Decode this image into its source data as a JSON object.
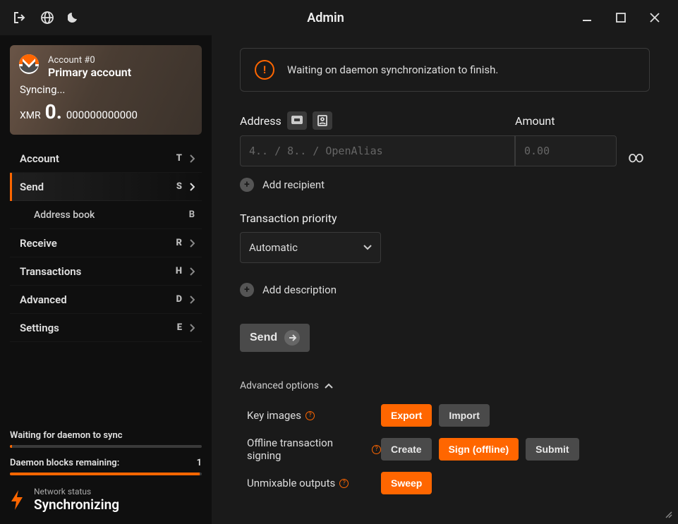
{
  "title": "Admin",
  "account": {
    "number_label": "Account #0",
    "name": "Primary account",
    "sync_status": "Syncing...",
    "currency": "XMR",
    "balance_whole": "0.",
    "balance_frac": "000000000000"
  },
  "nav": {
    "items": [
      {
        "label": "Account",
        "shortcut": "T"
      },
      {
        "label": "Send",
        "shortcut": "S"
      },
      {
        "label": "Address book",
        "shortcut": "B"
      },
      {
        "label": "Receive",
        "shortcut": "R"
      },
      {
        "label": "Transactions",
        "shortcut": "H"
      },
      {
        "label": "Advanced",
        "shortcut": "D"
      },
      {
        "label": "Settings",
        "shortcut": "E"
      }
    ]
  },
  "sidebar_status": {
    "wait_label": "Waiting for daemon to sync",
    "blocks_label": "Daemon blocks remaining:",
    "blocks_value": "1",
    "net_label": "Network status",
    "net_value": "Synchronizing"
  },
  "banner": {
    "text": "Waiting on daemon synchronization to finish."
  },
  "send_form": {
    "address_label": "Address",
    "address_placeholder": "4.. / 8.. / OpenAlias",
    "amount_label": "Amount",
    "amount_placeholder": "0.00",
    "add_recipient": "Add recipient",
    "priority_label": "Transaction priority",
    "priority_value": "Automatic",
    "add_description": "Add description",
    "send_label": "Send"
  },
  "advanced": {
    "toggle_label": "Advanced options",
    "key_images_label": "Key images",
    "export": "Export",
    "import": "Import",
    "offline_label": "Offline transaction signing",
    "create": "Create",
    "sign_offline": "Sign (offline)",
    "submit": "Submit",
    "unmixable_label": "Unmixable outputs",
    "sweep": "Sweep"
  }
}
